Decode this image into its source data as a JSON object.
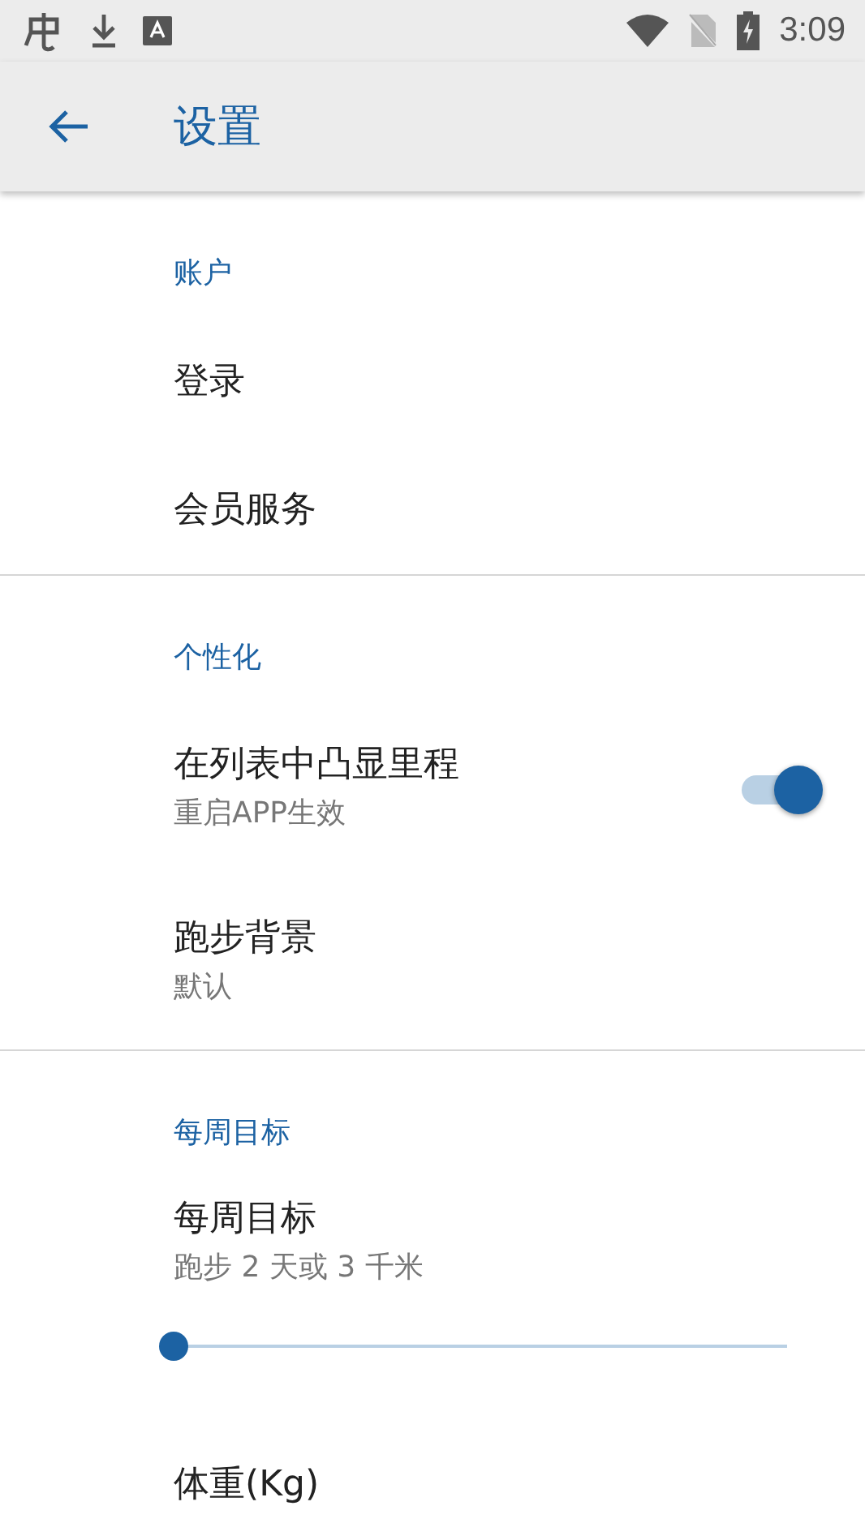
{
  "status_bar": {
    "time": "3:09"
  },
  "app_bar": {
    "title": "设置"
  },
  "sections": [
    {
      "header": "账户",
      "items": [
        {
          "kind": "plain",
          "title": "登录"
        },
        {
          "kind": "plain",
          "title": "会员服务"
        }
      ]
    },
    {
      "header": "个性化",
      "items": [
        {
          "kind": "switch",
          "title": "在列表中凸显里程",
          "summary": "重启APP生效",
          "on": true
        },
        {
          "kind": "plain",
          "title": "跑步背景",
          "summary": "默认"
        }
      ]
    },
    {
      "header": "每周目标",
      "items": [
        {
          "kind": "slider",
          "title": "每周目标",
          "summary": "跑步 2 天或 3 千米",
          "level": 0
        },
        {
          "kind": "plain",
          "title": "体重(Kg)"
        }
      ]
    }
  ]
}
